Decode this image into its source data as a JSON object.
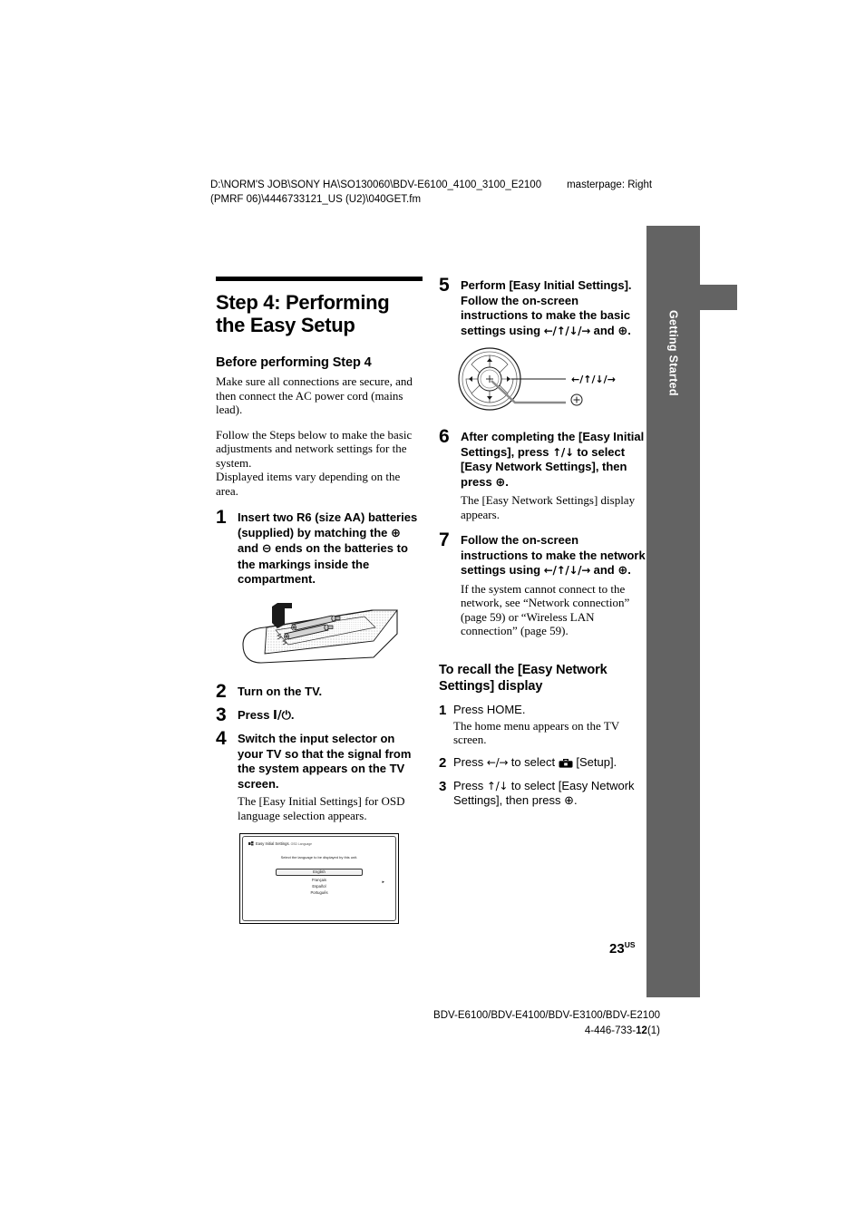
{
  "header": {
    "path_line1": "D:\\NORM'S JOB\\SONY HA\\SO130060\\BDV-E6100_4100_3100_E2100",
    "path_line2": "(PMRF 06)\\4446733121_US (U2)\\040GET.fm",
    "masterpage": "masterpage: Right"
  },
  "side_tab": {
    "label": "Getting Started",
    "color": "#636363"
  },
  "left_column": {
    "title": "Step 4: Performing the Easy Setup",
    "subhead": "Before performing Step 4",
    "intro_para1": "Make sure all connections are secure, and then connect the AC power cord (mains lead).",
    "intro_para2": "Follow the Steps below to make the basic adjustments and network settings for the system.",
    "intro_para3": "Displayed items vary depending on the area.",
    "steps": [
      {
        "num": "1",
        "title_parts": {
          "a": "Insert two R6 (size AA) batteries (supplied) by matching the ",
          "plus": "⊕",
          "b": " and ",
          "minus": "⊖",
          "c": " ends on the batteries to the markings inside the compartment."
        }
      },
      {
        "num": "2",
        "title": "Turn on the TV."
      },
      {
        "num": "3",
        "title_prefix": "Press ",
        "title_symbol": "I/⏻",
        "title_suffix": "."
      },
      {
        "num": "4",
        "title": "Switch the input selector on your TV so that the signal from the system appears on the TV screen.",
        "note": "The [Easy Initial Settings] for OSD language selection appears."
      }
    ],
    "osd_screen": {
      "title": "Easy Initial Settings",
      "subtitle": "- OSD Language",
      "prompt": "Select the language to be displayed by this unit.",
      "options": [
        "English",
        "Français",
        "Español",
        "Português"
      ],
      "selected": "English"
    }
  },
  "right_column": {
    "steps": [
      {
        "num": "5",
        "title_a": "Perform [Easy Initial Settings]. Follow the on-screen instructions to make the basic settings using ",
        "arrows": "←/↑/↓/→",
        "title_b": " and ",
        "enter": "⊕",
        "title_c": "."
      },
      {
        "num": "6",
        "title_a": "After completing the [Easy Initial Settings], press ",
        "arrows": "↑/↓",
        "title_b": " to select [Easy Network Settings], then press ",
        "enter": "⊕",
        "title_c": ".",
        "note": "The [Easy Network Settings] display appears."
      },
      {
        "num": "7",
        "title_a": "Follow the on-screen instructions to make the network settings using ",
        "arrows": "←/↑/↓/→",
        "title_b": " and ",
        "enter": "⊕",
        "title_c": ".",
        "note": "If the system cannot connect to the network, see “Network connection” (page 59) or “Wireless LAN connection” (page 59)."
      }
    ],
    "dpad_callout_arrows": "←/↑/↓/→",
    "dpad_callout_enter": "⊕",
    "recall_heading": "To recall the [Easy Network Settings] display",
    "recall_steps": [
      {
        "num": "1",
        "title": "Press HOME.",
        "note": "The home menu appears on the TV screen."
      },
      {
        "num": "2",
        "title_a": "Press ",
        "arrows": "←/→",
        "title_b": " to select ",
        "icon": "setup-toolbox-icon",
        "title_c": " [Setup]."
      },
      {
        "num": "3",
        "title_a": "Press ",
        "arrows": "↑/↓",
        "title_b": " to select [Easy Network Settings], then press ",
        "enter": "⊕",
        "title_c": "."
      }
    ]
  },
  "page_number": {
    "number": "23",
    "suffix": "US"
  },
  "footer": {
    "models": "BDV-E6100/BDV-E4100/BDV-E3100/BDV-E2100",
    "code_prefix": "4-446-733-",
    "code_bold": "12",
    "code_suffix": "(1)"
  }
}
